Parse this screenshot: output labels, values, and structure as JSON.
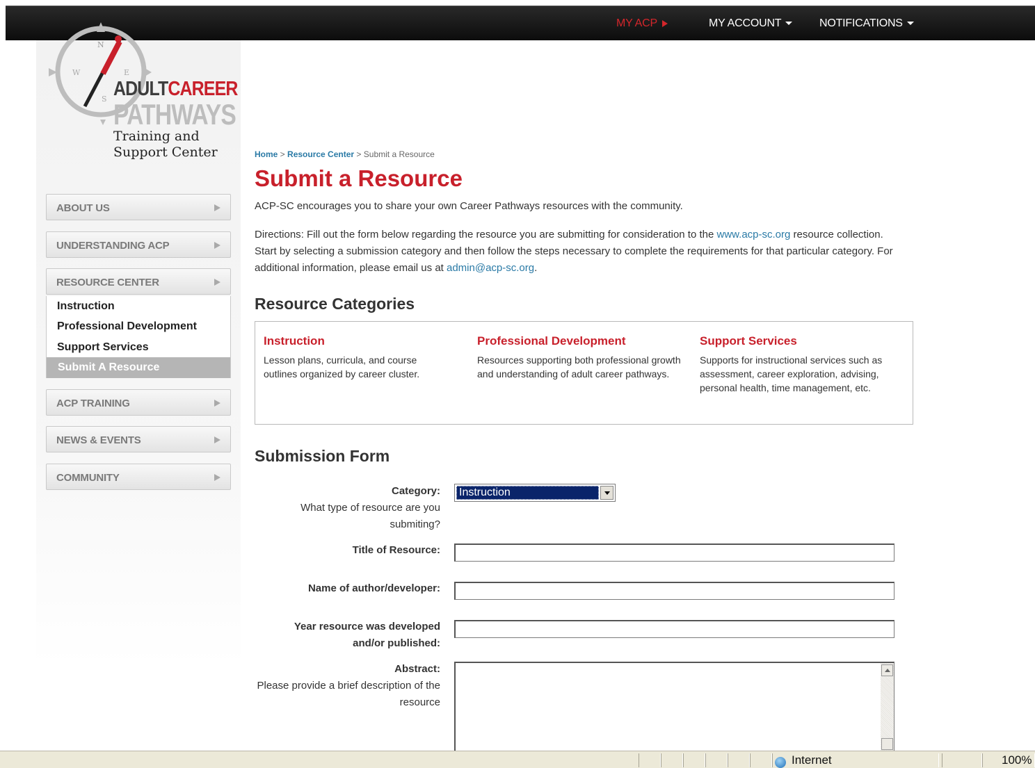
{
  "topnav": {
    "my_acp": "MY ACP",
    "my_account": "MY ACCOUNT",
    "notifications": "NOTIFICATIONS"
  },
  "logo": {
    "line1_a": "ADULT",
    "line1_b": "CAREER",
    "line2": "PATHWAYS",
    "line3": "Training and",
    "line4": "Support Center",
    "compass_letters": [
      "N",
      "W",
      "E",
      "S"
    ]
  },
  "sidebar": {
    "items": [
      {
        "label": "ABOUT US"
      },
      {
        "label": "UNDERSTANDING ACP"
      },
      {
        "label": "RESOURCE CENTER"
      },
      {
        "label": "ACP TRAINING"
      },
      {
        "label": "NEWS & EVENTS"
      },
      {
        "label": "COMMUNITY"
      }
    ],
    "submenu": [
      "Instruction",
      "Professional Development",
      "Support Services",
      "Submit A Resource"
    ]
  },
  "breadcrumb": {
    "home": "Home",
    "sep1": " > ",
    "resource_center": "Resource Center",
    "sep2": " > ",
    "current": "Submit a Resource"
  },
  "page": {
    "title": "Submit a Resource",
    "intro": "ACP-SC encourages you to share your own Career Pathways resources with the community.",
    "directions_label": "Directions",
    "directions_text1": ": Fill out the form below regarding the resource you are submitting for consideration to the ",
    "directions_link": "www.acp-sc.org",
    "directions_text2": " resource collection. Start by selecting a submission category and then follow the steps necessary to complete the requirements for that particular category. For additional information, please email us at ",
    "directions_email": "admin@acp-sc.org",
    "directions_end": "."
  },
  "categories": {
    "heading": "Resource Categories",
    "items": [
      {
        "title": "Instruction",
        "desc": "Lesson plans, curricula, and course outlines organized by career cluster."
      },
      {
        "title": "Professional Development",
        "desc": "Resources supporting both professional growth and understanding of adult career pathways."
      },
      {
        "title": "Support Services",
        "desc": "Supports for instructional services such as assessment, career exploration, advising, personal health, time management, etc."
      }
    ]
  },
  "form": {
    "heading": "Submission Form",
    "category_label": "Category:",
    "category_help": "What type of resource are you submiting?",
    "category_value": "Instruction",
    "title_label": "Title of Resource:",
    "title_value": "",
    "author_label": "Name of author/developer:",
    "author_value": "",
    "year_label": "Year resource was developed and/or published:",
    "year_value": "",
    "abstract_label": "Abstract:",
    "abstract_help": "Please provide a brief description of the resource",
    "abstract_value": ""
  },
  "statusbar": {
    "zone": "Internet",
    "zoom": "100%"
  },
  "colors": {
    "brand_red": "#c8202b",
    "link_blue": "#2a7aa6",
    "topbar": "#111111"
  }
}
